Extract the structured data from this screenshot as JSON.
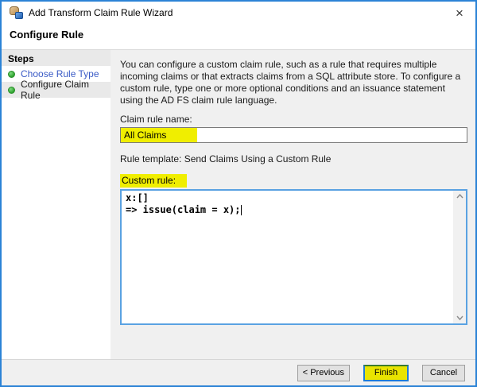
{
  "window": {
    "title": "Add Transform Claim Rule Wizard",
    "close_glyph": "×"
  },
  "header": {
    "title": "Configure Rule"
  },
  "sidebar": {
    "title": "Steps",
    "items": [
      {
        "label": "Choose Rule Type",
        "state": "done-link"
      },
      {
        "label": "Configure Claim Rule",
        "state": "current"
      }
    ]
  },
  "content": {
    "description": "You can configure a custom claim rule, such as a rule that requires multiple incoming claims or that extracts claims from a SQL attribute store. To configure a custom rule, type one or more optional conditions and an issuance statement using the AD FS claim rule language.",
    "claim_rule_name_label": "Claim rule name:",
    "claim_rule_name_value": "All Claims",
    "rule_template": "Rule template: Send Claims Using a Custom Rule",
    "custom_rule_label": "Custom rule:",
    "custom_rule_value": "x:[]\n=> issue(claim = x);"
  },
  "footer": {
    "previous_label": "< Previous",
    "finish_label": "Finish",
    "cancel_label": "Cancel"
  },
  "colors": {
    "window_border": "#2b83d6",
    "highlight_yellow": "#f0ee00",
    "step_bullet_green": "#2fa32f",
    "step_link_blue": "#3a5bc6",
    "focused_box_border": "#5aa2e2",
    "content_bg": "#f0f0f0"
  }
}
